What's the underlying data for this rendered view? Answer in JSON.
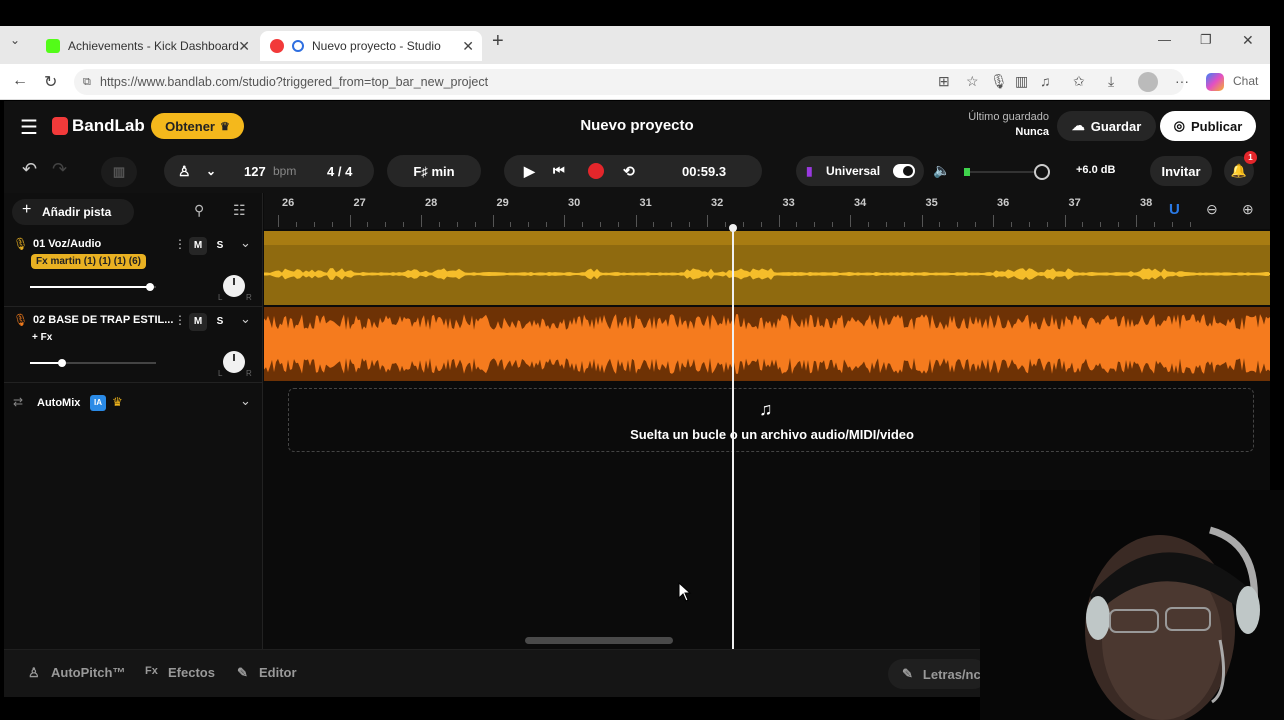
{
  "browser": {
    "tabs": [
      {
        "title": "Achievements - Kick Dashboard",
        "favicon_color": "#53fc18"
      },
      {
        "title": "Nuevo proyecto - Studio",
        "favicon_color": "#f23a3a"
      }
    ],
    "url": "https://www.bandlab.com/studio?triggered_from=top_bar_new_project",
    "chat_label": "Chat"
  },
  "app": {
    "brand": "BandLab",
    "get_button": "Obtener",
    "project_title": "Nuevo proyecto",
    "last_saved_label": "Último guardado",
    "last_saved_value": "Nunca",
    "save_button": "Guardar",
    "publish_button": "Publicar",
    "invite_button": "Invitar",
    "notifications_count": "1"
  },
  "transport": {
    "bpm": "127",
    "bpm_unit": "bpm",
    "time_signature": "4 / 4",
    "key": "F♯ min",
    "time": "00:59.3",
    "preset_label": "Universal",
    "volume_db": "+6.0 dB"
  },
  "tracks_panel": {
    "add_track": "Añadir pista",
    "tracks": [
      {
        "name": "01  Voz/Audio",
        "fx": "Fx martin (1) (1) (1) (6)",
        "mute": "M",
        "solo": "S",
        "volume": 0.95,
        "color": "#e9b122"
      },
      {
        "name": "02  BASE DE TRAP ESTIL...",
        "fx": "+ Fx",
        "mute": "M",
        "solo": "S",
        "volume": 0.25,
        "color": "#f07a1c"
      }
    ],
    "automix": "AutoMix",
    "automix_badge": "IA"
  },
  "ruler": {
    "bars": [
      "26",
      "27",
      "28",
      "29",
      "30",
      "31",
      "32",
      "33",
      "34",
      "35",
      "36",
      "37",
      "38"
    ]
  },
  "dropzone_text": "Suelta un bucle o un archivo audio/MIDI/video",
  "bottom_bar": {
    "autopitch": "AutoPitch™",
    "effects": "Efectos",
    "editor": "Editor",
    "lyrics": "Letras/nc"
  }
}
